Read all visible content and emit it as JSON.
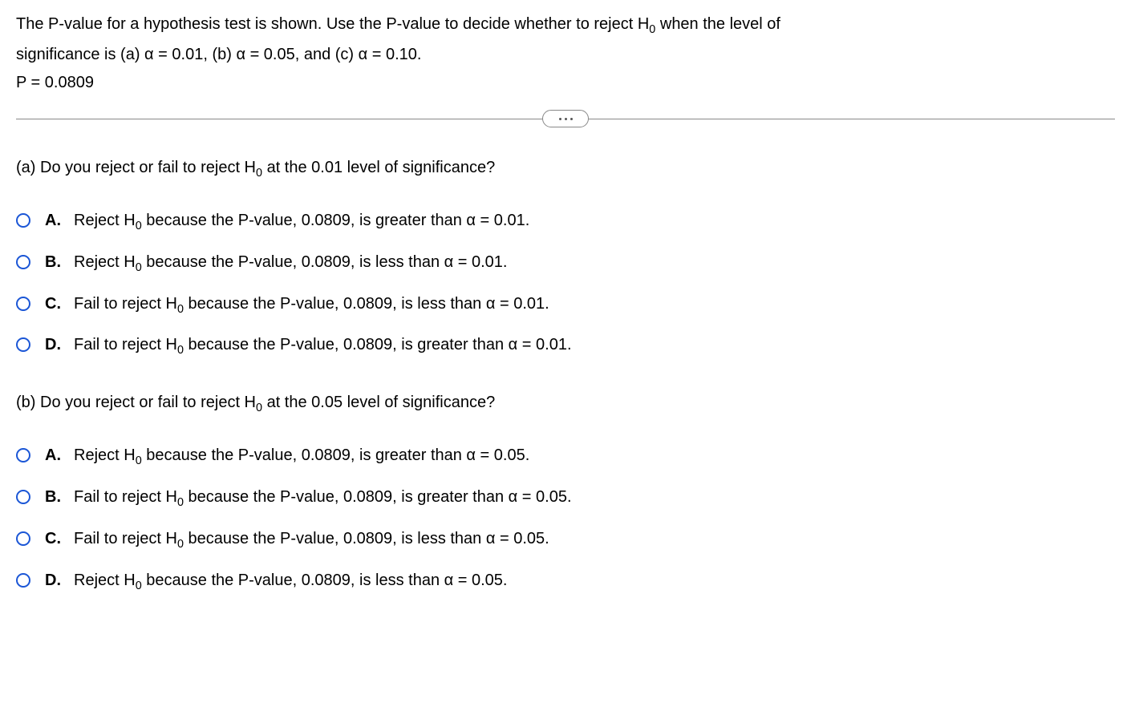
{
  "intro": {
    "line1_a": "The P-value for a hypothesis test is shown. Use the P-value to decide whether to reject H",
    "line1_sub": "0",
    "line1_b": "  when the level of",
    "line2": "significance is (a) α = 0.01, (b) α = 0.05, and (c) α = 0.10.",
    "pvalue": "P = 0.0809"
  },
  "qA": {
    "stem_a": "(a) Do you reject or fail to reject H",
    "stem_sub": "0",
    "stem_b": " at the 0.01 level of significance?",
    "options": [
      {
        "letter": "A.",
        "pre": "Reject  H",
        "sub": "0",
        "post": " because the P-value, 0.0809, is greater than α = 0.01."
      },
      {
        "letter": "B.",
        "pre": "Reject H",
        "sub": "0",
        "post": " because the P-value, 0.0809, is less than α = 0.01."
      },
      {
        "letter": "C.",
        "pre": "Fail to reject H",
        "sub": "0",
        "post": " because the P-value, 0.0809, is less than α = 0.01."
      },
      {
        "letter": "D.",
        "pre": "Fail to reject H",
        "sub": "0",
        "post": " because the P-value, 0.0809, is greater than α = 0.01."
      }
    ]
  },
  "qB": {
    "stem_a": "(b) Do you reject or fail to reject H",
    "stem_sub": "0",
    "stem_b": " at the 0.05 level of significance?",
    "options": [
      {
        "letter": "A.",
        "pre": "Reject H",
        "sub": "0",
        "post": " because the P-value, 0.0809, is greater than α = 0.05."
      },
      {
        "letter": "B.",
        "pre": "Fail to reject H",
        "sub": "0",
        "post": " because the P-value, 0.0809, is greater than α = 0.05."
      },
      {
        "letter": "C.",
        "pre": "Fail to reject H",
        "sub": "0",
        "post": " because the P-value, 0.0809, is less than α = 0.05."
      },
      {
        "letter": "D.",
        "pre": "Reject H",
        "sub": "0",
        "post": " because the P-value, 0.0809, is less than α = 0.05."
      }
    ]
  }
}
